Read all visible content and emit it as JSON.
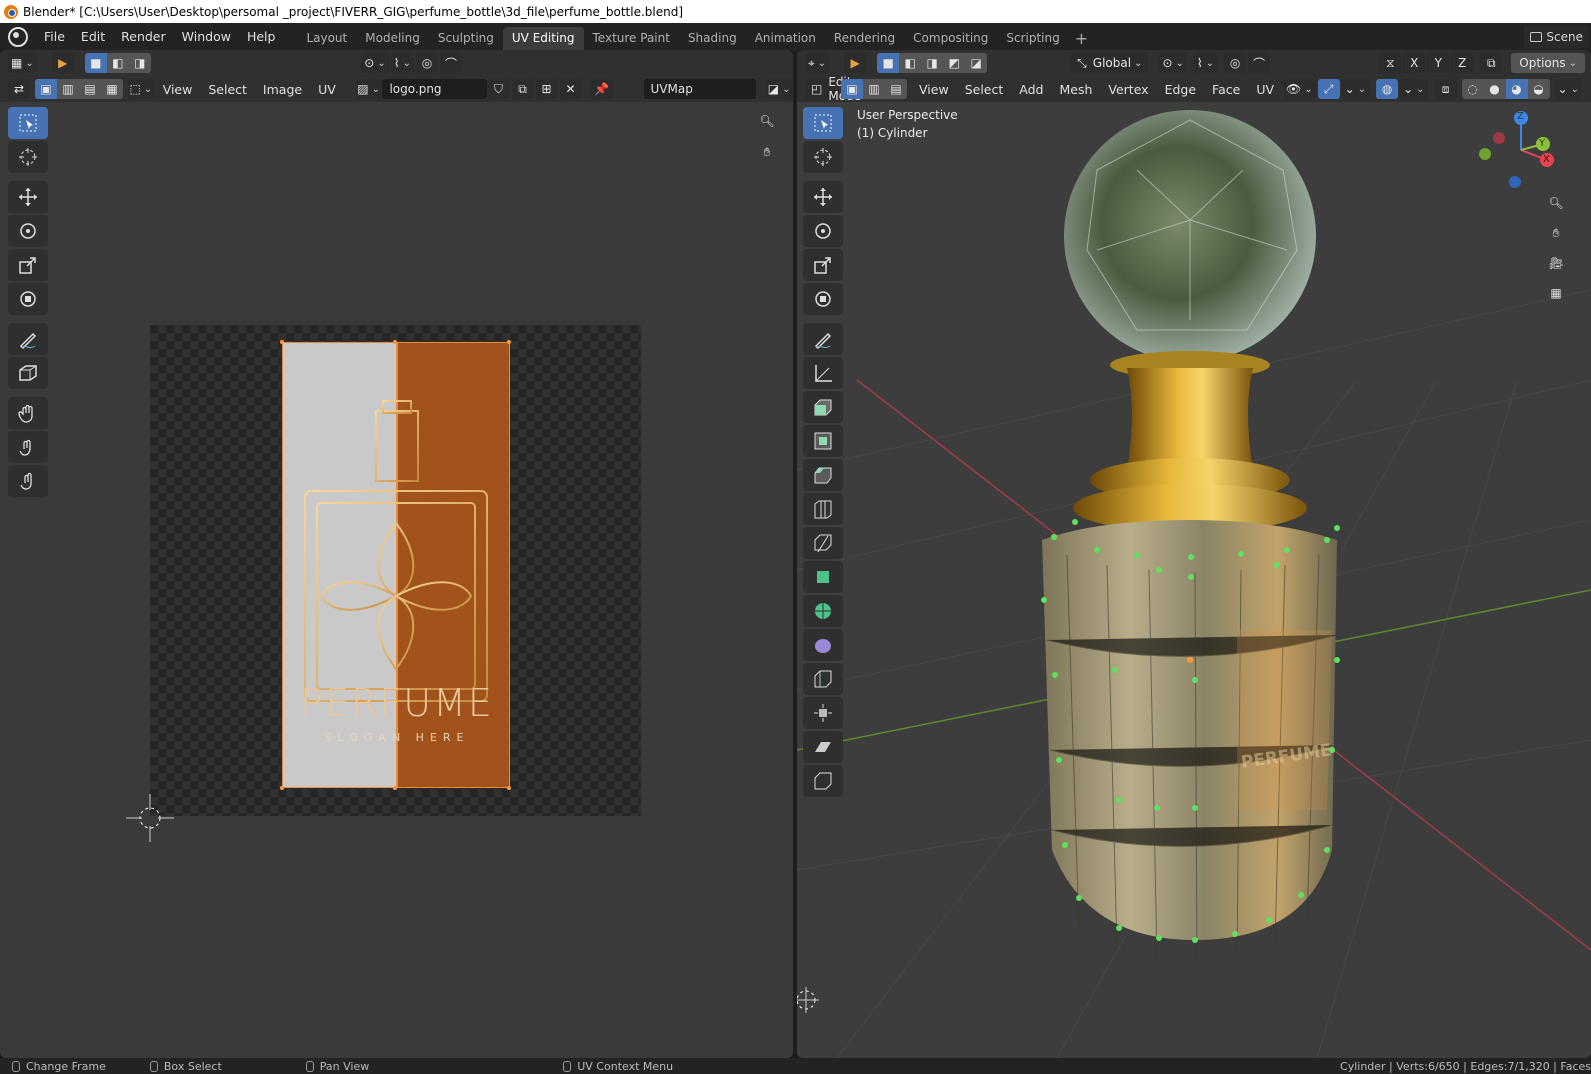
{
  "window": {
    "title": "Blender* [C:\\Users\\User\\Desktop\\persomal _project\\FIVERR_GIG\\perfume_bottle\\3d_file\\perfume_bottle.blend]"
  },
  "menu": [
    "File",
    "Edit",
    "Render",
    "Window",
    "Help"
  ],
  "workspaces": [
    "Layout",
    "Modeling",
    "Sculpting",
    "UV Editing",
    "Texture Paint",
    "Shading",
    "Animation",
    "Rendering",
    "Compositing",
    "Scripting"
  ],
  "active_workspace": "UV Editing",
  "scene_label": "Scene",
  "uv_editor": {
    "menus": [
      "View",
      "Select",
      "Image",
      "UV"
    ],
    "image_name": "logo.png",
    "uvmap": "UVMap",
    "logo_text": "PERFUME",
    "logo_slogan": "SLOGAN HERE"
  },
  "viewport": {
    "transform_orientation": "Global",
    "options_label": "Options",
    "mode": "Edit Mode",
    "menus": [
      "View",
      "Select",
      "Add",
      "Mesh",
      "Vertex",
      "Edge",
      "Face",
      "UV"
    ],
    "view_name": "User Perspective",
    "object_name": "(1) Cylinder",
    "axes": {
      "x": "X",
      "y": "Y",
      "z": "Z"
    },
    "axis_colors": {
      "x": "#e8434f",
      "y": "#8bc23a",
      "z": "#3f87e8"
    }
  },
  "statusbar": {
    "items": [
      "Change Frame",
      "Box Select",
      "Pan View",
      "UV Context Menu"
    ],
    "stats": "Cylinder | Verts:6/650 | Edges:7/1,320 | Faces"
  }
}
